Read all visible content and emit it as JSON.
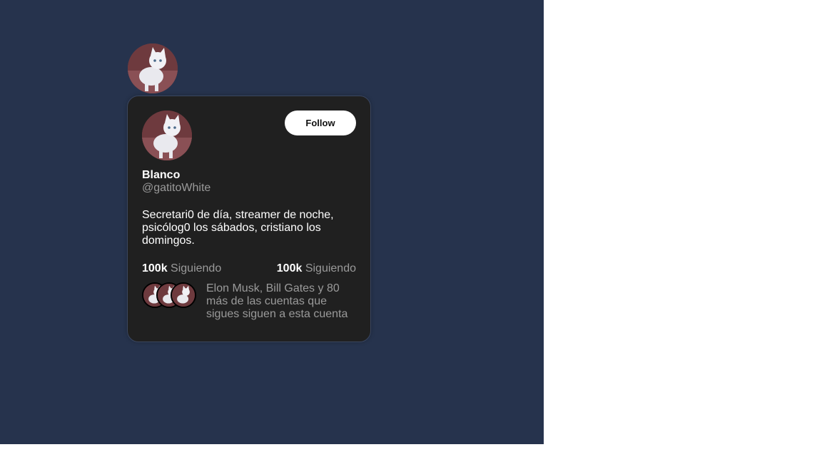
{
  "profile": {
    "name": "Blanco",
    "handle": "@gatitoWhite",
    "bio": "Secretari0 de día, streamer de noche, psicólog0 los sábados, cristiano los domingos.",
    "avatar_icon": "white-kitten-photo"
  },
  "actions": {
    "follow_label": "Follow"
  },
  "stats": {
    "left": {
      "count": "100k",
      "label": "Siguiendo"
    },
    "right": {
      "count": "100k",
      "label": "Siguiendo"
    }
  },
  "mutuals": {
    "text": "Elon Musk, Bill Gates y 80 más de las cuentas que sigues siguen a esta cuenta",
    "avatar_count": 3
  },
  "colors": {
    "page_background": "#26334d",
    "card_background": "#202020",
    "muted_text": "#9a9a9a",
    "follow_button": "#ffffff"
  }
}
